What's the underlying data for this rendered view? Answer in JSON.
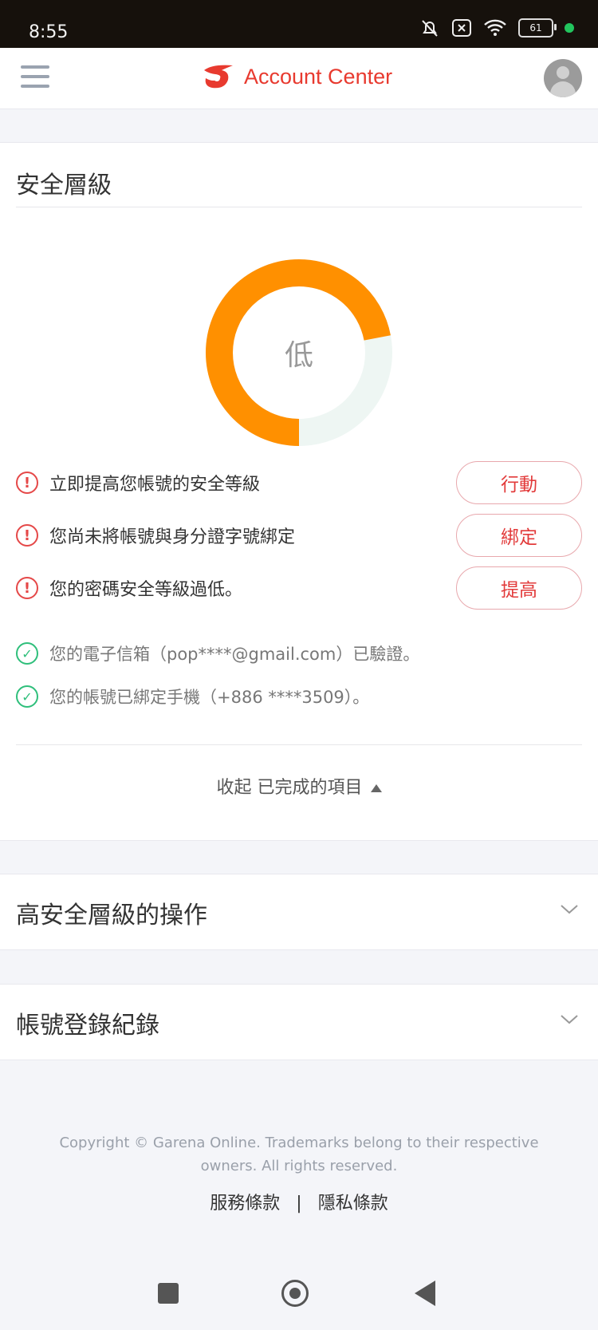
{
  "status_bar": {
    "time": "8:55",
    "battery": "61"
  },
  "header": {
    "brand_title": "Account Center"
  },
  "security": {
    "title": "安全層級",
    "level_label": "低",
    "level_fraction": 0.72,
    "warnings": [
      {
        "text": "立即提高您帳號的安全等級",
        "button": "行動"
      },
      {
        "text": "您尚未將帳號與身分證字號綁定",
        "button": "綁定"
      },
      {
        "text": "您的密碼安全等級過低。",
        "button": "提高"
      }
    ],
    "completed": [
      {
        "text": "您的電子信箱（pop****@gmail.com）已驗證。"
      },
      {
        "text": "您的帳號已綁定手機（+886 ****3509）。"
      }
    ],
    "collapse_label": "收起 已完成的項目"
  },
  "sections": [
    {
      "title": "高安全層級的操作"
    },
    {
      "title": "帳號登錄紀錄"
    }
  ],
  "footer": {
    "copyright": "Copyright © Garena Online. Trademarks belong to their respective owners. All rights reserved.",
    "terms": "服務條款",
    "separator": "|",
    "privacy": "隱私條款"
  },
  "colors": {
    "accent": "#e83a2f",
    "donut": "#ff9000",
    "donut_track": "#eef6f3",
    "warning": "#e54848",
    "success": "#2fbf7b"
  }
}
